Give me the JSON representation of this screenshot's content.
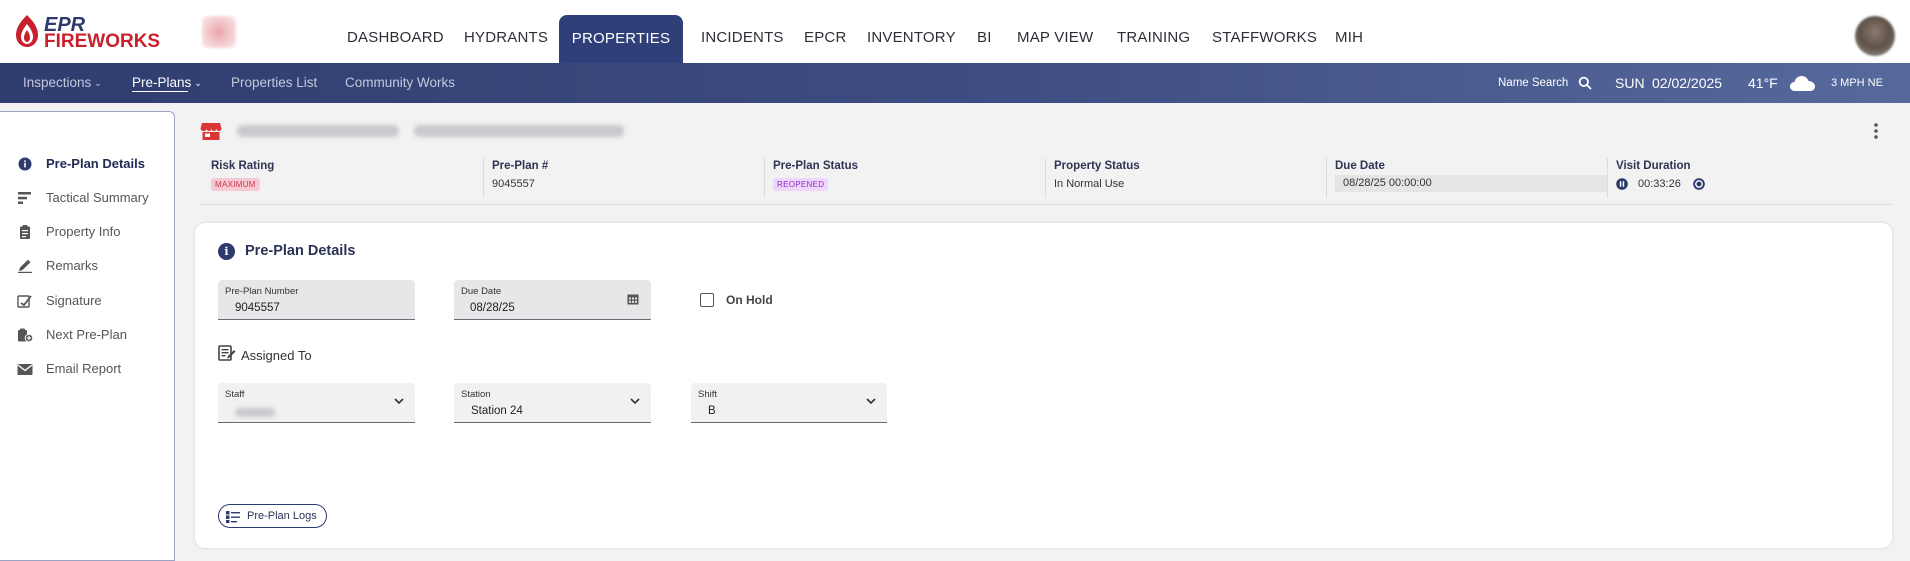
{
  "brand": {
    "line1": "EPR",
    "line2": "FIREWORKS"
  },
  "nav": {
    "items": [
      {
        "label": "DASHBOARD",
        "active": false
      },
      {
        "label": "HYDRANTS",
        "active": false
      },
      {
        "label": "PROPERTIES",
        "active": true
      },
      {
        "label": "INCIDENTS",
        "active": false
      },
      {
        "label": "EPCR",
        "active": false
      },
      {
        "label": "INVENTORY",
        "active": false
      },
      {
        "label": "BI",
        "active": false
      },
      {
        "label": "MAP VIEW",
        "active": false
      },
      {
        "label": "TRAINING",
        "active": false
      },
      {
        "label": "STAFFWORKS",
        "active": false
      },
      {
        "label": "MIH",
        "active": false
      }
    ]
  },
  "subnav": {
    "items": [
      {
        "label": "Inspections",
        "has_menu": true,
        "active": false
      },
      {
        "label": "Pre-Plans",
        "has_menu": true,
        "active": true
      },
      {
        "label": "Properties List",
        "has_menu": false,
        "active": false
      },
      {
        "label": "Community Works",
        "has_menu": false,
        "active": false
      }
    ],
    "name_search": "Name Search",
    "day": "SUN",
    "date": "02/02/2025",
    "temperature": "41°F",
    "weather_icon": "cloud-icon",
    "wind": "3 MPH NE"
  },
  "sidebar": {
    "items": [
      {
        "label": "Pre-Plan Details",
        "icon": "info-icon",
        "active": true
      },
      {
        "label": "Tactical Summary",
        "icon": "summary-bars-icon",
        "active": false
      },
      {
        "label": "Property Info",
        "icon": "clipboard-icon",
        "active": false
      },
      {
        "label": "Remarks",
        "icon": "pencil-icon",
        "active": false
      },
      {
        "label": "Signature",
        "icon": "signature-icon",
        "active": false
      },
      {
        "label": "Next Pre-Plan",
        "icon": "next-plan-icon",
        "active": false
      },
      {
        "label": "Email Report",
        "icon": "envelope-icon",
        "active": false
      }
    ]
  },
  "summary": {
    "risk_rating": {
      "label": "Risk Rating",
      "value": "MAXIMUM"
    },
    "preplan_number": {
      "label": "Pre-Plan #",
      "value": "9045557"
    },
    "preplan_status": {
      "label": "Pre-Plan Status",
      "value": "REOPENED"
    },
    "property_status": {
      "label": "Property Status",
      "value": "In Normal Use"
    },
    "due_date": {
      "label": "Due Date",
      "value": "08/28/25 00:00:00"
    },
    "visit_duration": {
      "label": "Visit Duration",
      "value": "00:33:26"
    }
  },
  "details": {
    "title": "Pre-Plan Details",
    "preplan_number": {
      "label": "Pre-Plan Number",
      "value": "9045557"
    },
    "due_date": {
      "label": "Due Date",
      "value": "08/28/25"
    },
    "on_hold": {
      "label": "On Hold",
      "checked": false
    },
    "assigned_to": "Assigned To",
    "staff": {
      "label": "Staff"
    },
    "station": {
      "label": "Station",
      "value": "Station 24"
    },
    "shift": {
      "label": "Shift",
      "value": "B"
    },
    "logs_button": "Pre-Plan Logs"
  },
  "colors": {
    "primary": "#2f3f77",
    "brand_red": "#c8202c",
    "badge_red": "#c93550",
    "badge_purple": "#8a2cc6"
  }
}
